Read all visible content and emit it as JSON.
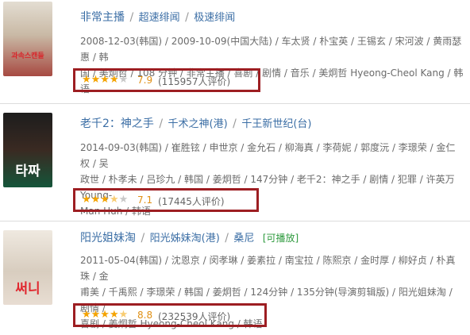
{
  "movies": [
    {
      "title": "非常主播",
      "alt_titles": [
        "超速绯闻",
        "极速绯闻"
      ],
      "play_tag": "",
      "meta_lines": [
        "2008-12-03(韩国) / 2009-10-09(中国大陆) / 车太贤 / 朴宝英 / 王锡玄 / 宋河波 / 黄雨瑟惠 / 韩",
        "国 / 美炯哲 / 108 分钟 / 非常主播 / 喜剧 / 剧情 / 音乐 / 美炯哲 Hyeong-Cheol Kang / 韩语"
      ],
      "stars": 4,
      "score": "7.9",
      "count": "(115957人评价)",
      "poster_text": "과속스캔들",
      "poster_colors": [
        "#d9d2c6",
        "#b54640"
      ]
    },
    {
      "title": "老千2：神之手",
      "alt_titles": [
        "千术之神(港)",
        "千王新世纪(台)"
      ],
      "play_tag": "",
      "meta_lines": [
        "2014-09-03(韩国) / 崔胜铉 / 申世京 / 金允石 / 柳海真 / 李荷妮 / 郭度沅 / 李璟荣 / 金仁权 / 吴",
        "政世 / 朴孝未 / 吕珍九 / 韩国 / 姜炯哲 / 147分钟 / 老千2：神之手 / 剧情 / 犯罪 / 许英万 Young-",
        "Man Huh / 韩语"
      ],
      "stars": 3.5,
      "score": "7.1",
      "count": "(17445人评价)",
      "poster_text": "타짜",
      "poster_colors": [
        "#2a2a2a",
        "#0f5a3a"
      ]
    },
    {
      "title": "阳光姐妹淘",
      "alt_titles": [
        "阳光姊妹淘(港)",
        "桑尼"
      ],
      "play_tag": "[可播放]",
      "meta_lines": [
        "2011-05-04(韩国) / 沈恩京 / 闵孝琳 / 姜素拉 / 南宝拉 / 陈熙京 / 金时厚 / 柳好贞 / 朴真珠 / 金",
        "甫美 / 千禹熙 / 李璟荣 / 韩国 / 姜炯哲 / 124分钟 / 135分钟(导演剪辑版) / 阳光姐妹淘 / 剧情 /",
        "喜剧 / 姜炯哲 Hyeong-Cheol Kang / 韩语"
      ],
      "stars": 4.5,
      "score": "8.8",
      "count": "(232539人评价)",
      "poster_text": "써니",
      "poster_colors": [
        "#e9e3d9",
        "#d43a3a"
      ]
    }
  ]
}
